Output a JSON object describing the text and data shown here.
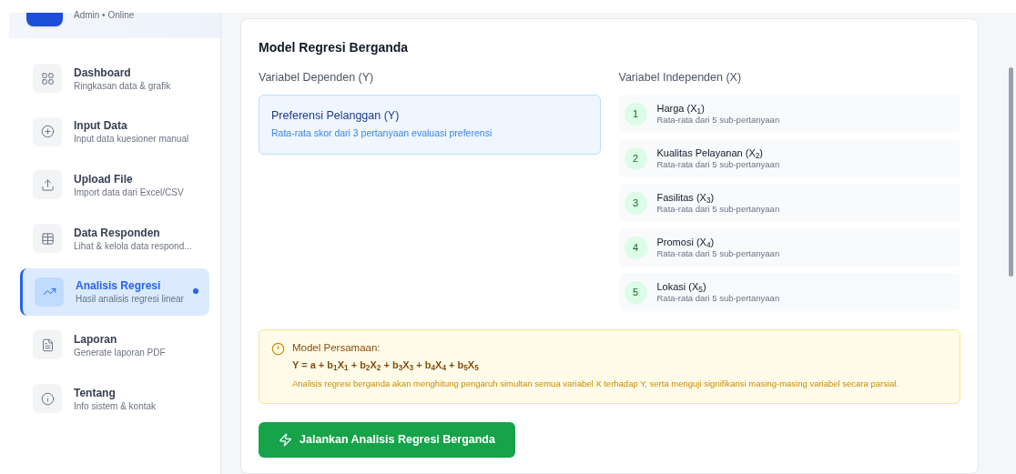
{
  "sidebar": {
    "user_status": "Admin • Online",
    "items": [
      {
        "title": "Dashboard",
        "subtitle": "Ringkasan data & grafik",
        "selected": false
      },
      {
        "title": "Input Data",
        "subtitle": "Input data kuesioner manual",
        "selected": false
      },
      {
        "title": "Upload File",
        "subtitle": "Import data dari Excel/CSV",
        "selected": false
      },
      {
        "title": "Data Responden",
        "subtitle": "Lihat & kelola data respond...",
        "selected": false
      },
      {
        "title": "Analisis Regresi",
        "subtitle": "Hasil analisis regresi linear",
        "selected": true
      },
      {
        "title": "Laporan",
        "subtitle": "Generate laporan PDF",
        "selected": false
      },
      {
        "title": "Tentang",
        "subtitle": "Info sistem & kontak",
        "selected": false
      }
    ]
  },
  "card": {
    "title": "Model Regresi Berganda",
    "dependent": {
      "heading": "Variabel Dependen (Y)",
      "name": "Preferensi Pelanggan (Y)",
      "description": "Rata-rata skor dari 3 pertanyaan evaluasi preferensi"
    },
    "independent": {
      "heading": "Variabel Independen (X)",
      "variables": [
        {
          "number": "1",
          "name": "Harga (X$_{1}$)",
          "description": "Rata-rata dari 5 sub-pertanyaan"
        },
        {
          "number": "2",
          "name": "Kualitas Pelayanan (X$_{2}$)",
          "description": "Rata-rata dari 5 sub-pertanyaan"
        },
        {
          "number": "3",
          "name": "Fasilitas (X$_{3}$)",
          "description": "Rata-rata dari 5 sub-pertanyaan"
        },
        {
          "number": "4",
          "name": "Promosi (X$_{4}$)",
          "description": "Rata-rata dari 5 sub-pertanyaan"
        },
        {
          "number": "5",
          "name": "Lokasi (X$_{5}$)",
          "description": "Rata-rata dari 5 sub-pertanyaan"
        }
      ]
    },
    "equation": {
      "title": "Model Persamaan:",
      "formula": "Y = a + b$_{1}$X$_{1}$ + b$_{2}$X$_{2}$ + b$_{3}$X$_{3}$ + b$_{4}$X$_{4}$ + b$_{5}$X$_{5}$",
      "note": "Analisis regresi berganda akan menghitung pengaruh simultan semua variabel X terhadap Y, serta menguji signifikansi masing-masing variabel secara parsial."
    },
    "run_button": "Jalankan Analisis Regresi Berganda"
  }
}
